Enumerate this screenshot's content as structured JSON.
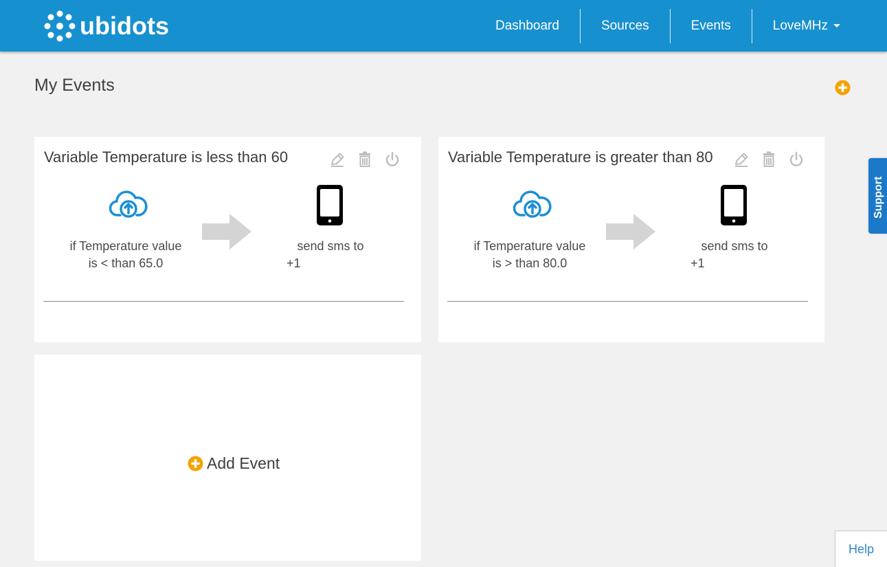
{
  "header": {
    "logo_text": "ubidots",
    "nav": [
      {
        "label": "Dashboard"
      },
      {
        "label": "Sources"
      },
      {
        "label": "Events"
      },
      {
        "label": "LoveMHz"
      }
    ]
  },
  "page": {
    "title": "My Events"
  },
  "events": [
    {
      "title": "Variable Temperature is less than 60",
      "condition_line1": "if Temperature value",
      "condition_line2": "is < than 65.0",
      "action_text": "send sms to",
      "action_phone": "+1"
    },
    {
      "title": "Variable Temperature is greater than 80",
      "condition_line1": "if Temperature value",
      "condition_line2": "is > than 80.0",
      "action_text": "send sms to",
      "action_phone": "+1"
    }
  ],
  "add_event": {
    "label": "Add Event"
  },
  "support": {
    "label": "Support"
  },
  "help": {
    "label": "Help"
  },
  "icons": {
    "edit": "pencil-icon",
    "delete": "trash-icon",
    "toggle": "power-icon",
    "trigger": "cloud-upload-icon",
    "arrow": "arrow-right-icon",
    "action": "smartphone-icon",
    "add": "plus-circle-icon"
  },
  "colors": {
    "header_bg": "#1790cf",
    "accent_orange": "#f5a300",
    "trigger_blue": "#1a8fd6",
    "support_blue": "#1c78c9",
    "page_bg": "#f1f1f1"
  }
}
